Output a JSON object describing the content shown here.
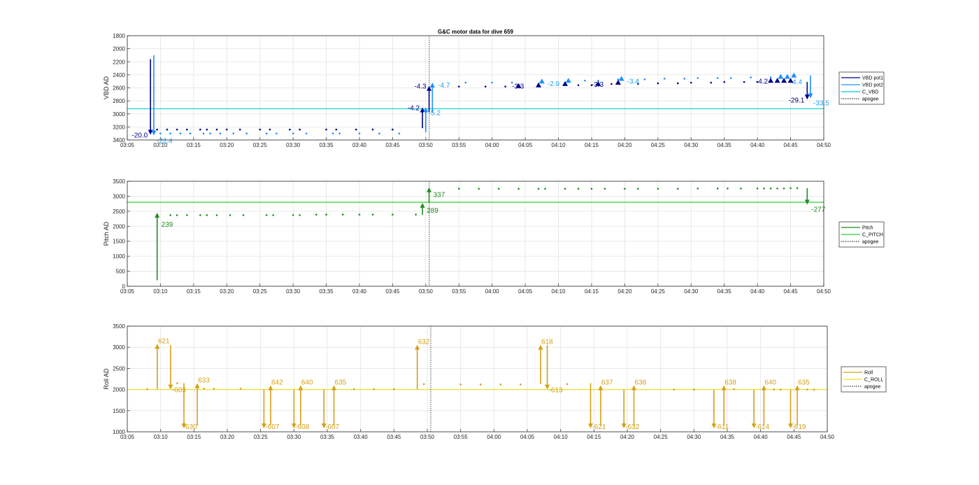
{
  "title": "G&C motor data for dive 659",
  "chart_data": [
    {
      "type": "scatter",
      "ylabel": "VBD AD",
      "ylim": [
        1800,
        3400
      ],
      "y_reversed": true,
      "yticks": [
        "1800",
        "2000",
        "2200",
        "2400",
        "2600",
        "2800",
        "3000",
        "3200",
        "3400"
      ],
      "xlim": [
        "03:05",
        "04:50"
      ],
      "xticks": [
        "03:05",
        "03:10",
        "03:15",
        "03:20",
        "03:25",
        "03:30",
        "03:35",
        "03:40",
        "03:45",
        "03:50",
        "03:55",
        "04:00",
        "04:05",
        "04:10",
        "04:15",
        "04:20",
        "04:25",
        "04:30",
        "04:35",
        "04:40",
        "04:45",
        "04:50"
      ],
      "grid": true,
      "apogee": "03:50",
      "colors": {
        "pot1": "#00008b",
        "pot2": "#1e90ff",
        "cline": "#00ced1",
        "mid": "#0000cd",
        "label1": "#00008b",
        "label2": "#1ea0f0"
      },
      "reference_line": {
        "name": "C_VBD",
        "value": 2920
      },
      "legend": {
        "position": "right",
        "entries": [
          {
            "name": "VBD pot1",
            "color": "#00008b",
            "style": "solid"
          },
          {
            "name": "VBD pot2",
            "color": "#1e90ff",
            "style": "solid"
          },
          {
            "name": "C_VBD",
            "color": "#00ced1",
            "style": "solid"
          },
          {
            "name": "apogee",
            "color": "#333333",
            "style": "dotted"
          }
        ]
      },
      "series": [
        {
          "name": "VBD pot1",
          "x": [
            "03:09.5",
            "03:11",
            "03:12.5",
            "03:14",
            "03:16",
            "03:17",
            "03:18.5",
            "03:20",
            "03:22",
            "03:25",
            "03:26.5",
            "03:29.5",
            "03:31",
            "03:35",
            "03:36.5",
            "03:39.5",
            "03:42",
            "03:45",
            "03:55",
            "03:59",
            "04:02",
            "04:13",
            "04:15",
            "04:18",
            "04:22",
            "04:25",
            "04:28",
            "04:30",
            "04:33",
            "04:35",
            "04:38",
            "04:40",
            "04:45"
          ],
          "y": [
            3240,
            3240,
            3240,
            3240,
            3240,
            3240,
            3240,
            3240,
            3240,
            3240,
            3240,
            3240,
            3240,
            3240,
            3240,
            3240,
            3240,
            3240,
            2580,
            2580,
            2580,
            2560,
            2560,
            2540,
            2540,
            2530,
            2530,
            2520,
            2520,
            2510,
            2510,
            2510,
            2500
          ]
        },
        {
          "name": "VBD pot2",
          "x": [
            "03:10",
            "03:11.5",
            "03:13",
            "03:14.5",
            "03:16.5",
            "03:17.5",
            "03:19",
            "03:21",
            "03:23",
            "03:26",
            "03:27.5",
            "03:30",
            "03:32",
            "03:36",
            "03:37",
            "03:40",
            "03:43",
            "03:46",
            "03:56",
            "04:00",
            "04:03",
            "04:14",
            "04:16",
            "04:19",
            "04:23",
            "04:26",
            "04:29",
            "04:31",
            "04:34",
            "04:36",
            "04:39",
            "04:42"
          ],
          "y": [
            3300,
            3300,
            3300,
            3300,
            3300,
            3300,
            3300,
            3300,
            3300,
            3300,
            3300,
            3300,
            3300,
            3300,
            3300,
            3300,
            3300,
            3300,
            2520,
            2520,
            2520,
            2490,
            2490,
            2470,
            2470,
            2460,
            2460,
            2450,
            2450,
            2450,
            2440,
            2440
          ]
        }
      ],
      "arrows": [
        {
          "series": "VBD pot1",
          "x": "03:08.5",
          "from": 2160,
          "to": 3320,
          "label": "-20.0",
          "label_side": "left"
        },
        {
          "series": "VBD pot2",
          "x": "03:09",
          "from": 2100,
          "to": 3330,
          "label": "-22.4",
          "label_side": "below"
        },
        {
          "series": "VBD pot1",
          "x": "03:49.5",
          "from": 3220,
          "to": 2900,
          "label": "-4.2",
          "label_side": "left"
        },
        {
          "series": "VBD pot2",
          "x": "03:50",
          "from": 3280,
          "to": 2900,
          "label": "-5.2",
          "label_side": "below"
        },
        {
          "series": "VBD pot1",
          "x": "03:50.5",
          "from": 2970,
          "to": 2570,
          "label": "-4.3",
          "label_side": "left"
        },
        {
          "series": "VBD pot2",
          "x": "03:51",
          "from": 2980,
          "to": 2520,
          "label": "-4.7",
          "label_side": "right"
        },
        {
          "series": "VBD pot1",
          "x": "04:04",
          "from": 2570,
          "to": 2570,
          "label": "-3.3",
          "label_side": "none"
        },
        {
          "series": "VBD pot1",
          "x": "04:07",
          "from": 2560,
          "to": 2560,
          "label": "",
          "label_side": "none"
        },
        {
          "series": "VBD pot2",
          "x": "04:07.5",
          "from": 2500,
          "to": 2500,
          "label": "-2.9",
          "label_side": "right"
        },
        {
          "series": "VBD pot1",
          "x": "04:11",
          "from": 2540,
          "to": 2540,
          "label": "",
          "label_side": "none"
        },
        {
          "series": "VBD pot2",
          "x": "04:11.5",
          "from": 2490,
          "to": 2490,
          "label": "",
          "label_side": "none"
        },
        {
          "series": "VBD pot1",
          "x": "04:16",
          "from": 2540,
          "to": 2540,
          "label": "-3.3",
          "label_side": "none"
        },
        {
          "series": "VBD pot1",
          "x": "04:19",
          "from": 2520,
          "to": 2520,
          "label": "",
          "label_side": "none"
        },
        {
          "series": "VBD pot2",
          "x": "04:19.5",
          "from": 2460,
          "to": 2460,
          "label": "-3.4",
          "label_side": "right"
        },
        {
          "series": "VBD pot1",
          "x": "04:42",
          "from": 2490,
          "to": 2490,
          "label": "-4.2",
          "label_side": "left"
        },
        {
          "series": "VBD pot1",
          "x": "04:43",
          "from": 2490,
          "to": 2490,
          "label": "",
          "label_side": "none"
        },
        {
          "series": "VBD pot2",
          "x": "04:43.5",
          "from": 2430,
          "to": 2430,
          "label": "",
          "label_side": "none"
        },
        {
          "series": "VBD pot1",
          "x": "04:44",
          "from": 2490,
          "to": 2490,
          "label": "",
          "label_side": "none"
        },
        {
          "series": "VBD pot2",
          "x": "04:44.5",
          "from": 2430,
          "to": 2430,
          "label": "-4.4",
          "label_side": "below"
        },
        {
          "series": "VBD pot1",
          "x": "04:45",
          "from": 2490,
          "to": 2490,
          "label": "",
          "label_side": "none"
        },
        {
          "series": "VBD pot2",
          "x": "04:45.5",
          "from": 2410,
          "to": 2410,
          "label": "",
          "label_side": "none"
        },
        {
          "series": "VBD pot1",
          "x": "04:47.5",
          "from": 2510,
          "to": 2780,
          "label": "-29.1",
          "label_side": "left"
        },
        {
          "series": "VBD pot2",
          "x": "04:48",
          "from": 2410,
          "to": 2760,
          "label": "-33.5",
          "label_side": "belowright"
        }
      ]
    },
    {
      "type": "scatter",
      "ylabel": "Pitch AD",
      "ylim": [
        0,
        3500
      ],
      "y_reversed": false,
      "yticks": [
        "0",
        "500",
        "1000",
        "1500",
        "2000",
        "2500",
        "3000",
        "3500"
      ],
      "xlim": [
        "03:05",
        "04:50"
      ],
      "xticks": [
        "03:05",
        "03:10",
        "03:15",
        "03:20",
        "03:25",
        "03:30",
        "03:35",
        "03:40",
        "03:45",
        "03:50",
        "03:55",
        "04:00",
        "04:05",
        "04:10",
        "04:15",
        "04:20",
        "04:25",
        "04:30",
        "04:35",
        "04:40",
        "04:45",
        "04:50"
      ],
      "grid": true,
      "apogee": "03:50",
      "colors": {
        "main": "#228b22",
        "cline": "#32cd32",
        "label": "#228b22"
      },
      "reference_line": {
        "name": "C_PITCH",
        "value": 2800
      },
      "legend": {
        "position": "right",
        "entries": [
          {
            "name": "Pitch",
            "color": "#228b22",
            "style": "solid"
          },
          {
            "name": "C_PITCH",
            "color": "#32cd32",
            "style": "solid"
          },
          {
            "name": "apogee",
            "color": "#333333",
            "style": "dotted"
          }
        ]
      },
      "series": [
        {
          "name": "Pitch",
          "x": [
            "03:11.5",
            "03:12.5",
            "03:14",
            "03:16",
            "03:17",
            "03:18.5",
            "03:20.5",
            "03:22.5",
            "03:26",
            "03:27",
            "03:30",
            "03:31",
            "03:33.5",
            "03:35",
            "03:37.5",
            "03:40",
            "03:42",
            "03:45",
            "03:48.5",
            "03:55",
            "03:58",
            "04:01",
            "04:04",
            "04:07",
            "04:08",
            "04:11",
            "04:13",
            "04:15",
            "04:17",
            "04:20",
            "04:22",
            "04:25",
            "04:28",
            "04:31",
            "04:34",
            "04:35.5",
            "04:37.5",
            "04:40",
            "04:41",
            "04:42",
            "04:43",
            "04:44",
            "04:45",
            "04:46"
          ],
          "y": [
            2370,
            2370,
            2370,
            2370,
            2370,
            2370,
            2370,
            2370,
            2370,
            2370,
            2370,
            2370,
            2390,
            2390,
            2390,
            2390,
            2390,
            2390,
            2390,
            3250,
            3250,
            3250,
            3250,
            3250,
            3250,
            3250,
            3250,
            3250,
            3250,
            3250,
            3250,
            3250,
            3250,
            3260,
            3260,
            3260,
            3260,
            3260,
            3260,
            3260,
            3260,
            3260,
            3270,
            3270
          ]
        }
      ],
      "arrows": [
        {
          "x": "03:09.5",
          "from": 200,
          "to": 2450,
          "label": "239"
        },
        {
          "x": "03:49.5",
          "from": 2380,
          "to": 2780,
          "label": "289"
        },
        {
          "x": "03:50.5",
          "from": 2780,
          "to": 3300,
          "label": "337"
        },
        {
          "x": "04:47.5",
          "from": 3270,
          "to": 2720,
          "label": "-277"
        }
      ]
    },
    {
      "type": "scatter",
      "ylabel": "Roll AD",
      "ylim": [
        1000,
        3500
      ],
      "y_reversed": false,
      "yticks": [
        "1000",
        "1500",
        "2000",
        "2500",
        "3000",
        "3500"
      ],
      "xlim": [
        "03:05",
        "04:50"
      ],
      "xticks": [
        "03:05",
        "03:10",
        "03:15",
        "03:20",
        "03:25",
        "03:30",
        "03:35",
        "03:40",
        "03:45",
        "03:50",
        "03:55",
        "04:00",
        "04:05",
        "04:10",
        "04:15",
        "04:20",
        "04:25",
        "04:30",
        "04:35",
        "04:40",
        "04:45",
        "04:50"
      ],
      "grid": true,
      "apogee": "03:50",
      "colors": {
        "main": "#d4a017",
        "cline": "#f0e020",
        "label": "#d4a017"
      },
      "reference_line": {
        "name": "C_ROLL",
        "value": 2000
      },
      "legend": {
        "position": "right",
        "entries": [
          {
            "name": "Roll",
            "color": "#d4a017",
            "style": "solid"
          },
          {
            "name": "C_ROLL",
            "color": "#f0e020",
            "style": "solid"
          },
          {
            "name": "apogee",
            "color": "#333333",
            "style": "dotted"
          }
        ]
      },
      "series": [
        {
          "name": "Roll",
          "x": [
            "03:08",
            "03:12.5",
            "03:16.5",
            "03:18",
            "03:22",
            "03:39",
            "03:42",
            "03:45",
            "03:49.5",
            "03:55",
            "03:58",
            "04:01",
            "04:04",
            "04:11",
            "04:27",
            "04:30",
            "04:36",
            "04:42",
            "04:43",
            "04:47",
            "04:48"
          ],
          "y": [
            2010,
            2150,
            2020,
            2020,
            2020,
            2010,
            2010,
            2010,
            2130,
            2120,
            2120,
            2120,
            2120,
            2130,
            2000,
            2000,
            2010,
            2000,
            2000,
            2000,
            2000
          ]
        }
      ],
      "arrows": [
        {
          "x": "03:09.5",
          "from": 2010,
          "to": 3080,
          "label": "621",
          "lpos": "above"
        },
        {
          "x": "03:11.5",
          "from": 3050,
          "to": 2000,
          "label": "-603",
          "lpos": "below"
        },
        {
          "x": "03:13.5",
          "from": 2150,
          "to": 1080,
          "label": "630",
          "lpos": "belowright"
        },
        {
          "x": "03:15.5",
          "from": 1150,
          "to": 2150,
          "label": "633",
          "lpos": "above"
        },
        {
          "x": "03:25.5",
          "from": 2000,
          "to": 1080,
          "label": "-607",
          "lpos": "belowright"
        },
        {
          "x": "03:26.5",
          "from": 1150,
          "to": 2100,
          "label": "642",
          "lpos": "above"
        },
        {
          "x": "03:30",
          "from": 2000,
          "to": 1080,
          "label": "-608",
          "lpos": "belowright"
        },
        {
          "x": "03:31",
          "from": 1150,
          "to": 2100,
          "label": "640",
          "lpos": "above"
        },
        {
          "x": "03:34.5",
          "from": 2000,
          "to": 1080,
          "label": "-607",
          "lpos": "belowright"
        },
        {
          "x": "03:36",
          "from": 1150,
          "to": 2100,
          "label": "635",
          "lpos": "above"
        },
        {
          "x": "03:48.5",
          "from": 2010,
          "to": 3060,
          "label": "632",
          "lpos": "above"
        },
        {
          "x": "04:07",
          "from": 2130,
          "to": 3060,
          "label": "618",
          "lpos": "above"
        },
        {
          "x": "04:08",
          "from": 3050,
          "to": 2000,
          "label": "-613",
          "lpos": "below"
        },
        {
          "x": "04:14.5",
          "from": 2150,
          "to": 1080,
          "label": "-621",
          "lpos": "belowright"
        },
        {
          "x": "04:16",
          "from": 1150,
          "to": 2100,
          "label": "637",
          "lpos": "above"
        },
        {
          "x": "04:19.5",
          "from": 2000,
          "to": 1080,
          "label": "-632",
          "lpos": "belowright"
        },
        {
          "x": "04:21",
          "from": 1150,
          "to": 2100,
          "label": "638",
          "lpos": "above"
        },
        {
          "x": "04:33",
          "from": 2000,
          "to": 1080,
          "label": "-611",
          "lpos": "belowright"
        },
        {
          "x": "04:34.5",
          "from": 1150,
          "to": 2100,
          "label": "638",
          "lpos": "above"
        },
        {
          "x": "04:39",
          "from": 2000,
          "to": 1080,
          "label": "-614",
          "lpos": "belowright"
        },
        {
          "x": "04:40.5",
          "from": 1150,
          "to": 2100,
          "label": "640",
          "lpos": "above"
        },
        {
          "x": "04:44.5",
          "from": 2000,
          "to": 1080,
          "label": "-619",
          "lpos": "belowright"
        },
        {
          "x": "04:45.5",
          "from": 1150,
          "to": 2100,
          "label": "635",
          "lpos": "above"
        }
      ]
    }
  ]
}
